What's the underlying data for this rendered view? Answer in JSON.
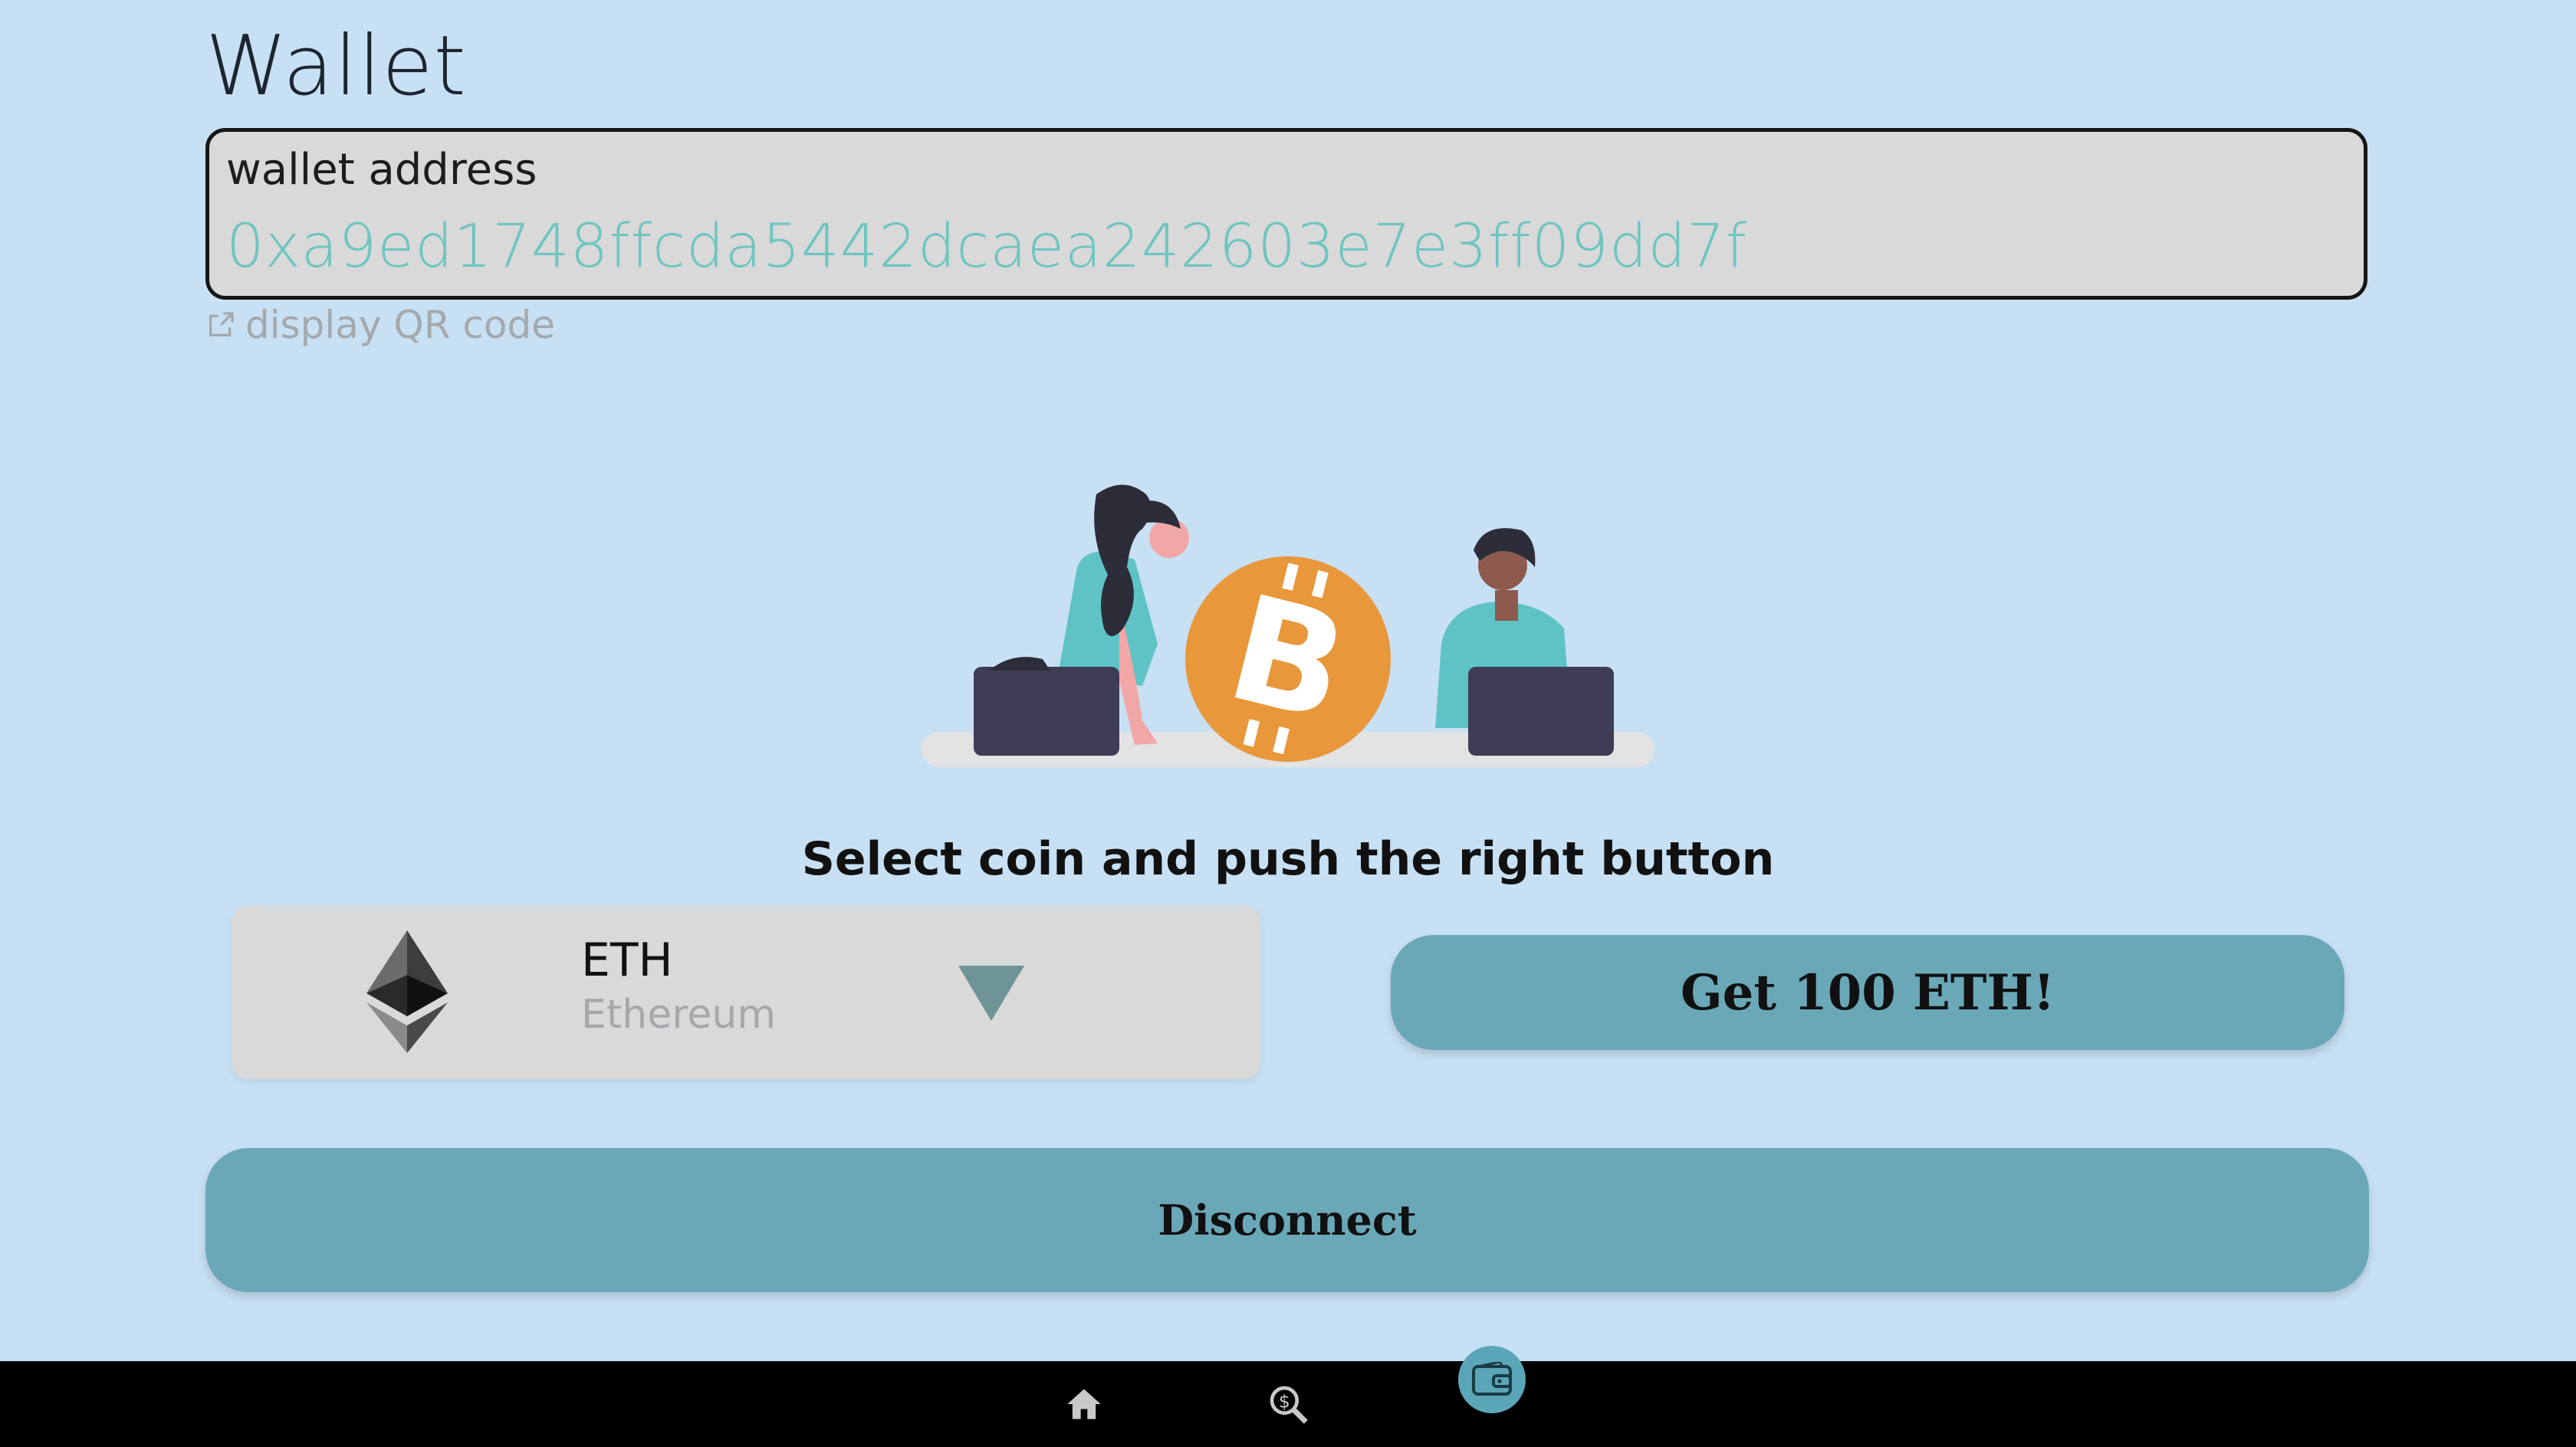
{
  "page": {
    "title": "Wallet"
  },
  "wallet": {
    "address_label": "wallet address",
    "address_value": "0xa9ed1748ffcda5442dcaea242603e7e3ff09dd7f",
    "qr_link_label": "display QR code"
  },
  "faucet": {
    "instruction": "Select coin and push the right button",
    "selected_coin": {
      "symbol": "ETH",
      "name": "Ethereum",
      "icon": "ethereum-icon"
    },
    "request_button_label": "Get 100 ETH!"
  },
  "actions": {
    "disconnect_label": "Disconnect"
  },
  "bottom_nav": {
    "items": [
      {
        "name": "home",
        "icon": "home-icon",
        "active": false
      },
      {
        "name": "search",
        "icon": "coin-search-icon",
        "active": false
      },
      {
        "name": "wallet",
        "icon": "wallet-icon",
        "active": true
      }
    ]
  },
  "colors": {
    "background": "#c8e0f3",
    "accent": "#6aa8b8",
    "address_text": "#6dc5c0",
    "nav_background": "#000000",
    "bitcoin_orange": "#e8973a"
  }
}
